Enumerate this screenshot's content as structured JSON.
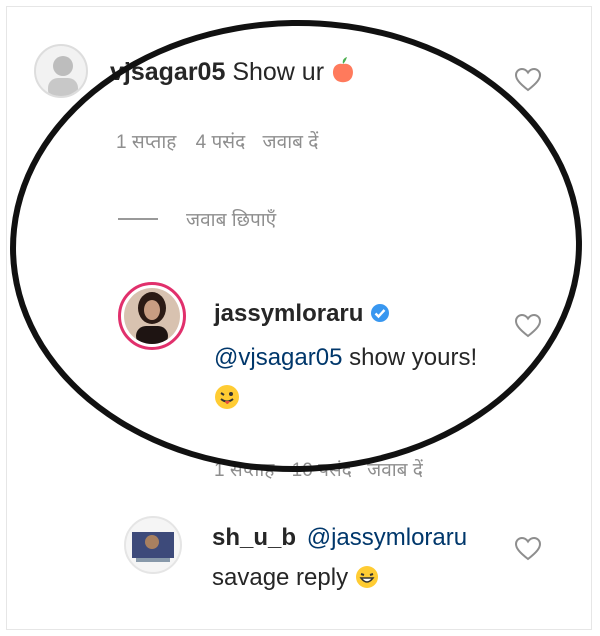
{
  "comments": [
    {
      "username": "vjsagar05",
      "text": "Show ur",
      "emoji": "peach-emoji",
      "meta": {
        "time": "1 सप्ताह",
        "likes": "4 पसंद",
        "reply": "जवाब दें"
      }
    }
  ],
  "hide_replies": "जवाब छिपाएँ",
  "reply": {
    "username": "jassymloraru",
    "verified": true,
    "mention": "@vjsagar05",
    "text": "show yours!",
    "emoji": "winking-tongue-emoji",
    "meta": {
      "time": "1 सप्ताह",
      "likes": "10 पसंद",
      "reply": "जवाब दें"
    }
  },
  "comment2": {
    "username": "sh_u_b",
    "mention": "@jassymloraru",
    "text": "savage reply",
    "emoji": "laughing-emoji"
  },
  "colors": {
    "mention": "#00376b",
    "verified": "#3897f0",
    "meta": "#8e8e8e",
    "annotation": "#111111"
  }
}
